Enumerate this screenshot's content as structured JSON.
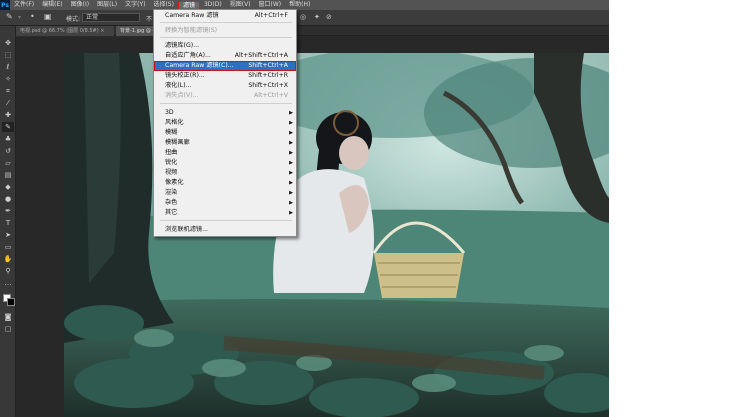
{
  "menubar": {
    "logo": "Ps",
    "items": [
      {
        "label": "文件(F)"
      },
      {
        "label": "编辑(E)"
      },
      {
        "label": "图像(I)"
      },
      {
        "label": "图层(L)"
      },
      {
        "label": "文字(Y)"
      },
      {
        "label": "选择(S)"
      },
      {
        "label": "滤镜"
      },
      {
        "label": "3D(D)"
      },
      {
        "label": "视图(V)"
      },
      {
        "label": "窗口(W)"
      },
      {
        "label": "帮助(H)"
      }
    ]
  },
  "options": {
    "brush_size": "•",
    "mode_label": "模式:",
    "mode_value": "正常",
    "opacity_label": "不"
  },
  "tabs": [
    {
      "label": "电视.psd @ 66.7% (图层 0/8.5#) ×"
    },
    {
      "label": "背景-1.jpg @ 66.7%"
    }
  ],
  "filter_menu": {
    "items": [
      {
        "label": "Camera Raw 滤镜",
        "shortcut": "Alt+Ctrl+F",
        "disabled": false
      },
      {
        "label": "转换为智能滤镜(S)",
        "shortcut": "",
        "disabled": true
      },
      {
        "label": "滤镜库(G)...",
        "shortcut": "",
        "disabled": false
      },
      {
        "label": "自适应广角(A)...",
        "shortcut": "Alt+Shift+Ctrl+A",
        "disabled": false
      },
      {
        "label": "Camera Raw 滤镜(C)...",
        "shortcut": "Shift+Ctrl+A",
        "disabled": false,
        "highlighted": true
      },
      {
        "label": "镜头校正(R)...",
        "shortcut": "Shift+Ctrl+R",
        "disabled": false
      },
      {
        "label": "液化(L)...",
        "shortcut": "Shift+Ctrl+X",
        "disabled": false
      },
      {
        "label": "消失点(V)...",
        "shortcut": "Alt+Ctrl+V",
        "disabled": true
      },
      {
        "label": "3D",
        "submenu": true
      },
      {
        "label": "风格化",
        "submenu": true
      },
      {
        "label": "模糊",
        "submenu": true
      },
      {
        "label": "模糊画廊",
        "submenu": true
      },
      {
        "label": "扭曲",
        "submenu": true
      },
      {
        "label": "锐化",
        "submenu": true
      },
      {
        "label": "视频",
        "submenu": true
      },
      {
        "label": "像素化",
        "submenu": true
      },
      {
        "label": "渲染",
        "submenu": true
      },
      {
        "label": "杂色",
        "submenu": true
      },
      {
        "label": "其它",
        "submenu": true
      },
      {
        "label": "浏览联机滤镜...",
        "shortcut": ""
      }
    ]
  },
  "colors": {
    "highlight": "#2f6fbf",
    "callout_red": "#c8141e"
  }
}
